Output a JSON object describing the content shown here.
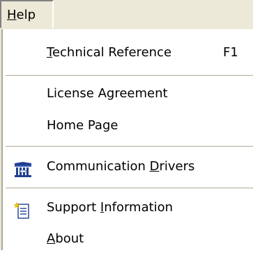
{
  "menubar": {
    "menu_label_mnemonic": "H",
    "menu_label_rest": "elp"
  },
  "menu": {
    "technical_reference": {
      "mnemonic": "T",
      "rest": "echnical Reference",
      "shortcut": "F1"
    },
    "license_agreement": {
      "label": "License Agreement"
    },
    "home_page": {
      "label": "Home Page"
    },
    "communication_drivers": {
      "prefix": "Communication ",
      "mnemonic": "D",
      "rest": "rivers",
      "icon": "communication-drivers-icon"
    },
    "support_information": {
      "prefix": "Support ",
      "mnemonic": "I",
      "rest": "nformation",
      "icon": "support-information-icon"
    },
    "about": {
      "mnemonic": "A",
      "rest": "bout"
    }
  },
  "colors": {
    "menubar_bg": "#ece9d8",
    "menu_bg": "#ffffff",
    "separator": "#aca899",
    "icon_blue": "#1f3f8f"
  }
}
